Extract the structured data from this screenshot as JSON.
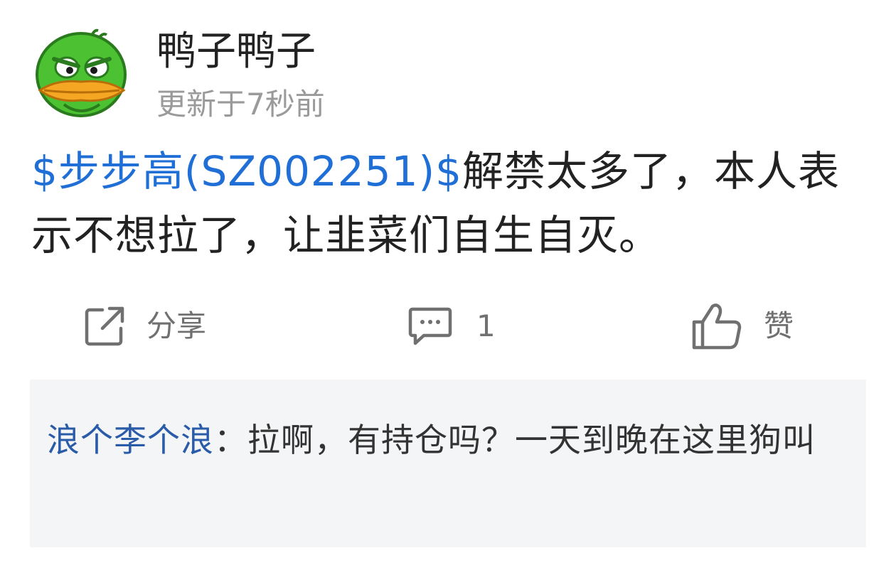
{
  "post": {
    "author": {
      "name": "鸭子鸭子",
      "avatar_icon": "duck-avatar-icon"
    },
    "timestamp": "更新于7秒前",
    "content": {
      "stock_tag": "$步步高(SZ002251)$",
      "text": "解禁太多了，本人表示不想拉了，让韭菜们自生自灭。"
    },
    "actions": {
      "share": {
        "icon": "share-icon",
        "label": "分享"
      },
      "comment": {
        "icon": "comment-icon",
        "count": "1"
      },
      "like": {
        "icon": "thumbs-up-icon",
        "label": "赞"
      }
    },
    "comments": [
      {
        "author": "浪个李个浪",
        "separator": "：",
        "text": "拉啊，有持仓吗？一天到晚在这里狗叫"
      }
    ]
  },
  "colors": {
    "link_blue": "#1f6fd6",
    "comment_author_blue": "#2a5ba8",
    "muted_gray": "#9a9a9a",
    "action_gray": "#707070",
    "comment_bg": "#f4f5f7"
  }
}
